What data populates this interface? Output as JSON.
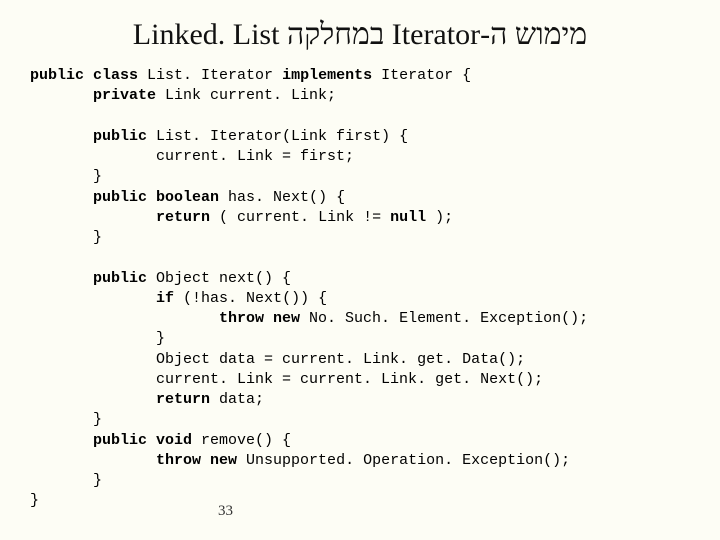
{
  "title": "מימוש ה-Iterator במחלקה Linked. List",
  "code": {
    "l01_pre": "",
    "l01_kw": "public class",
    "l01_post": " List. Iterator ",
    "l01_kw2": "implements",
    "l01_post2": " Iterator {",
    "l02_pre": "       ",
    "l02_kw": "private",
    "l02_post": " Link current. Link;",
    "l03": "",
    "l04_pre": "       ",
    "l04_kw": "public",
    "l04_post": " List. Iterator(Link first) {",
    "l05": "              current. Link = first;",
    "l06": "       }",
    "l07_pre": "       ",
    "l07_kw": "public boolean",
    "l07_post": " has. Next() {",
    "l08_pre": "              ",
    "l08_kw": "return",
    "l08_post": " ( current. Link != ",
    "l08_kw2": "null",
    "l08_post2": " );",
    "l09": "       }",
    "l10": "",
    "l11_pre": "       ",
    "l11_kw": "public",
    "l11_post": " Object next() {",
    "l12_pre": "              ",
    "l12_kw": "if",
    "l12_post": " (!has. Next()) {",
    "l13_pre": "                     ",
    "l13_kw": "throw new",
    "l13_post": " No. Such. Element. Exception();",
    "l14": "              }",
    "l15": "              Object data = current. Link. get. Data();",
    "l16": "              current. Link = current. Link. get. Next();",
    "l17_pre": "              ",
    "l17_kw": "return",
    "l17_post": " data;",
    "l18": "       }",
    "l19_pre": "       ",
    "l19_kw": "public void",
    "l19_post": " remove() {",
    "l20_pre": "              ",
    "l20_kw": "throw new",
    "l20_post": " Unsupported. Operation. Exception();",
    "l21": "       }",
    "l22": "}"
  },
  "page_number": "33"
}
